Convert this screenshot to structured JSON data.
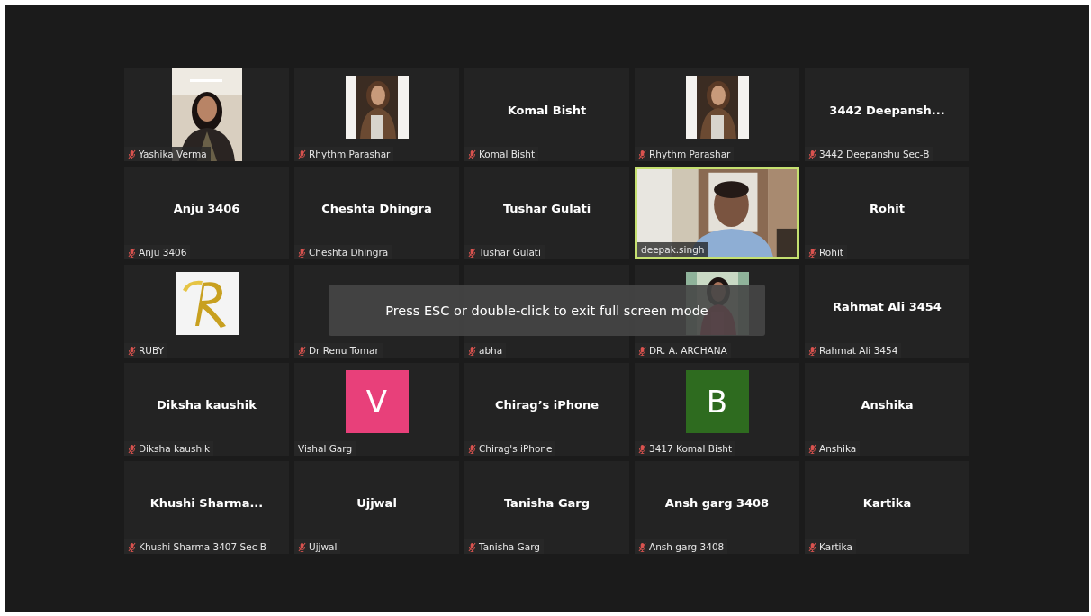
{
  "tiles": [
    {
      "kind": "portrait",
      "name": "Yashika Verma",
      "muted": true,
      "speaking": false
    },
    {
      "name": "Rhythm Parashar",
      "muted": true,
      "speaking": false
    },
    {
      "kind": "name",
      "title": "Komal Bisht",
      "name": "Komal Bisht",
      "muted": true,
      "speaking": false
    },
    {
      "name": "Rhythm Parashar",
      "muted": true,
      "speaking": false
    },
    {
      "kind": "name",
      "title": "3442  Deepansh...",
      "name": "3442 Deepanshu Sec-B",
      "muted": true,
      "speaking": false
    },
    {
      "kind": "name",
      "title": "Anju 3406",
      "name": "Anju 3406",
      "muted": true,
      "speaking": false
    },
    {
      "kind": "name",
      "title": "Cheshta Dhingra",
      "name": "Cheshta Dhingra",
      "muted": true,
      "speaking": false
    },
    {
      "kind": "name",
      "title": "Tushar Gulati",
      "name": "Tushar Gulati",
      "muted": true,
      "speaking": false
    },
    {
      "kind": "video",
      "name": "deepak.singh",
      "muted": false,
      "speaking": true
    },
    {
      "kind": "name",
      "title": "Rohit",
      "name": "Rohit",
      "muted": true,
      "speaking": false
    },
    {
      "kind": "logo",
      "name": "RUBY",
      "muted": true,
      "speaking": false
    },
    {
      "kind": "covered",
      "name": "Dr Renu Tomar",
      "muted": true,
      "speaking": false
    },
    {
      "kind": "covered",
      "name": "abha",
      "muted": true,
      "speaking": false
    },
    {
      "name": "DR. A. ARCHANA",
      "muted": true,
      "speaking": false
    },
    {
      "kind": "name",
      "title": "Rahmat Ali 3454",
      "name": "Rahmat Ali 3454",
      "muted": true,
      "speaking": false
    },
    {
      "kind": "name",
      "title": "Diksha kaushik",
      "name": "Diksha kaushik",
      "muted": true,
      "speaking": false
    },
    {
      "kind": "avatar",
      "letter": "V",
      "color": "#e8407a",
      "name": "Vishal Garg",
      "muted": false,
      "speaking": false
    },
    {
      "kind": "name",
      "title": "Chirag’s iPhone",
      "name": "Chirag's iPhone",
      "muted": true,
      "speaking": false
    },
    {
      "kind": "avatar",
      "letter": "B",
      "color": "#2e6b1f",
      "name": "3417 Komal Bisht",
      "muted": true,
      "speaking": false
    },
    {
      "kind": "name",
      "title": "Anshika",
      "name": "Anshika",
      "muted": true,
      "speaking": false
    },
    {
      "kind": "name",
      "title": "Khushi  Sharma...",
      "name": "Khushi Sharma 3407 Sec-B",
      "muted": true,
      "speaking": false
    },
    {
      "kind": "name",
      "title": "Ujjwal",
      "name": "Ujjwal",
      "muted": true,
      "speaking": false
    },
    {
      "kind": "name",
      "title": "Tanisha Garg",
      "name": "Tanisha Garg",
      "muted": true,
      "speaking": false
    },
    {
      "kind": "name",
      "title": "Ansh garg 3408",
      "name": "Ansh garg 3408",
      "muted": true,
      "speaking": false
    },
    {
      "kind": "name",
      "title": "Kartika",
      "name": "Kartika",
      "muted": true,
      "speaking": false
    }
  ],
  "toast": {
    "text": "Press ESC or double-click to exit full screen mode"
  }
}
